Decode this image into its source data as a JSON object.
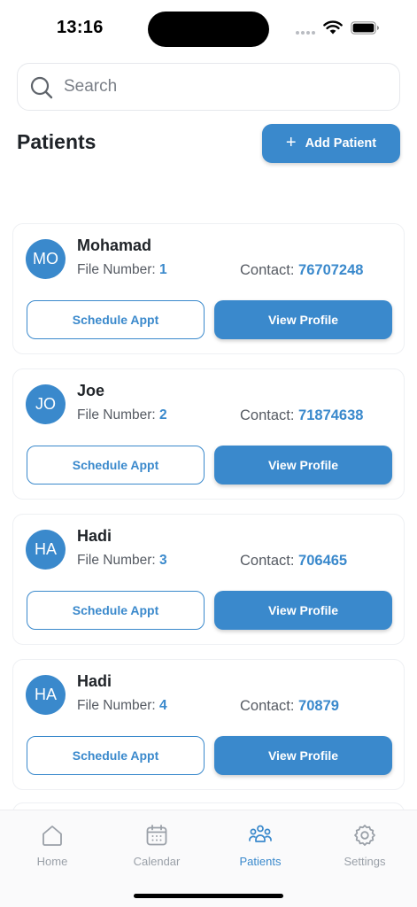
{
  "status_bar": {
    "time": "13:16"
  },
  "search": {
    "placeholder": "Search",
    "value": ""
  },
  "header": {
    "title": "Patients",
    "add_button_label": "Add Patient",
    "add_button_icon": "plus-icon"
  },
  "labels": {
    "file_number": "File Number:",
    "contact": "Contact:"
  },
  "patients": [
    {
      "initials": "MO",
      "name": "Mohamad",
      "file_number": "1",
      "contact": "76707248",
      "schedule_label": "Schedule Appt",
      "view_label": "View Profile"
    },
    {
      "initials": "JO",
      "name": "Joe",
      "file_number": "2",
      "contact": "71874638",
      "schedule_label": "Schedule Appt",
      "view_label": "View Profile"
    },
    {
      "initials": "HA",
      "name": "Hadi",
      "file_number": "3",
      "contact": "706465",
      "schedule_label": "Schedule Appt",
      "view_label": "View Profile"
    },
    {
      "initials": "HA",
      "name": "Hadi",
      "file_number": "4",
      "contact": "70879",
      "schedule_label": "Schedule Appt",
      "view_label": "View Profile"
    }
  ],
  "tabbar": {
    "items": [
      {
        "label": "Home",
        "icon": "home-icon",
        "active": false
      },
      {
        "label": "Calendar",
        "icon": "calendar-icon",
        "active": false
      },
      {
        "label": "Patients",
        "icon": "patients-icon",
        "active": true
      },
      {
        "label": "Settings",
        "icon": "gear-icon",
        "active": false
      }
    ]
  },
  "colors": {
    "accent": "#3a89cc",
    "inactive": "#9aa0a8",
    "text": "#1f2328"
  }
}
